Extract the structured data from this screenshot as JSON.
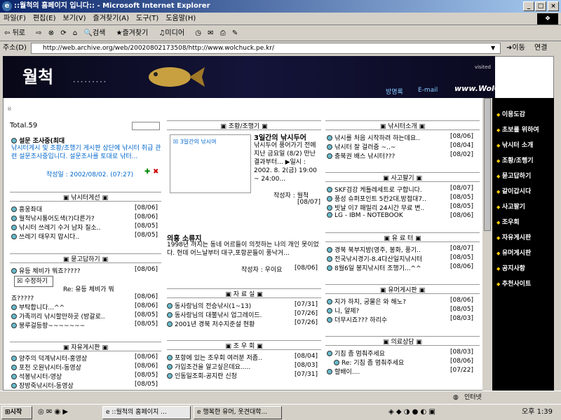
{
  "window": {
    "title": "::월척의 홈페이지 입니다:: - Microsoft Internet Explorer",
    "btn_min": "_",
    "btn_max": "□",
    "btn_close": "×"
  },
  "menu": [
    "파일(F)",
    "편집(E)",
    "보기(V)",
    "즐겨찾기(A)",
    "도구(T)",
    "도움말(H)"
  ],
  "toolbar": {
    "back": "뒤로",
    "search": "검색",
    "favorites": "즐겨찾기",
    "media": "미디어"
  },
  "address": {
    "label": "주소(D)",
    "url": "http://web.archive.org/web/20020802173508/http://www.wolchuck.pe.kr/",
    "go": "이동",
    "links": "연결"
  },
  "banner": {
    "logo": "월척",
    "visited": "visited",
    "nav1": "방명록",
    "nav2": "E-mail",
    "site": "www.WolChuck.pe.kr"
  },
  "sidebar": [
    "이용도감",
    "초보를 위하여",
    "낚시터 소개",
    "조황/조행기",
    "묻고답하기",
    "같이갑시다",
    "사고팔기",
    "조우회",
    "자유게시판",
    "유머게시판",
    "공지사항",
    "추천사이트"
  ],
  "left": {
    "total": "Total.59",
    "survey_title": "설문 조사중(최대",
    "survey_text": "낚시터게시 및 조황/조행기 게시판 상단에 낚시터 취급 관련 설문조사중입니다. 설문조사를 토대로 낚터...",
    "survey_date": "작성일 : 2002/08/02. (07:27)",
    "fish_title": "낚시터게선",
    "fish": [
      {
        "t": "흥웅좌대",
        "d": "[08/06]"
      },
      {
        "t": "월척낚시통어도색(?)다른가?",
        "d": "[08/06]"
      },
      {
        "t": "낚시터 쓰레기 수거 남자 질소..",
        "d": "[08/05]"
      },
      {
        "t": "쓰레기 태우지 맙시다..",
        "d": "[08/05]"
      }
    ],
    "qa_title": "묻고답하기",
    "qa": [
      {
        "t": "유등 체비가 뭐죠?????",
        "d": "[08/06]"
      },
      {
        "t": "Re: 유등 체비가 뭐",
        "d": ""
      },
      {
        "t": "죠?????",
        "d": "[08/06]"
      },
      {
        "t": "부탁합니다...^^",
        "d": "[08/06]"
      },
      {
        "t": "가족끼리 낚시할만하곳 (방갈로..",
        "d": "[08/05]"
      },
      {
        "t": "붕루걸등팡~~~~~~~",
        "d": "[08/05]"
      }
    ],
    "qa_popup": "수정하기",
    "free_title": "자유게시판",
    "free": [
      {
        "t": "양주의 덕계낚시터-홍영상",
        "d": "[08/06]"
      },
      {
        "t": "포천 오원낚시터-동영상",
        "d": "[08/06]"
      },
      {
        "t": "석봉낚시터-영상",
        "d": "[08/05]"
      },
      {
        "t": "장방죽낚시터-동영상",
        "d": "[08/05]"
      }
    ]
  },
  "mid": {
    "report_title": "조황/조행기",
    "report_img": "3일간의 낚시여",
    "report_head": "3일간의 낚시두어",
    "report_body": "낚시두어 풍어가기 전에 지난 금요일 (8/2) 만난 결과부터... ▶일시 : 2002. 8. 2(금) 19:00 ~ 24:00...",
    "report_author": "작성자 : 월척",
    "report_date": "[08/07]",
    "essay_title": "의흥 소류지",
    "essay_body": "1998년 까지는 동네 어르들이 의젓하는 나의 개인 못이었다. 헌데 어느날부터 대구,포항꾼들이 풍낙거...",
    "essay_author": "작성자 : 우이요",
    "essay_date": "[08/06]",
    "data_title": "자 료 실",
    "data": [
      {
        "t": "동사랑님의 전승낚시(1~13)",
        "d": "[07/31]"
      },
      {
        "t": "동사랑님의 대불낚시 업그레이드.",
        "d": "[07/26]"
      },
      {
        "t": "2001년 경북 저수지준설 현황",
        "d": "[07/26]"
      }
    ],
    "club_title": "조 우 회",
    "club": [
      {
        "t": "포항에 있는 조우회 여러분 저좀..",
        "d": "[08/04]"
      },
      {
        "t": "가입조건을 알고싶은데요.....",
        "d": "[08/03]"
      },
      {
        "t": "인동일조회-공지란 신청",
        "d": "[07/31]"
      }
    ]
  },
  "right": {
    "intro_title": "낚시터소개",
    "intro": [
      {
        "t": "낚시를 처음 시작하려 하는데요..",
        "d": "[08/06]"
      },
      {
        "t": "낚시터 잘 걸러줌 ~..~",
        "d": "[08/04]"
      },
      {
        "t": "충북권 배스 낚시터???",
        "d": "[08/02]"
      }
    ],
    "trade_title": "사고팔기",
    "trade": [
      {
        "t": "SKF검강 케틀레세트로 구합니다.",
        "d": "[08/07]"
      },
      {
        "t": "풍성 슈퍼포인트 5칸2대,방접대7..",
        "d": "[08/05]"
      },
      {
        "t": "빗날 이7 패밀리 24시간 무료 변..",
        "d": "[08/05]"
      },
      {
        "t": "LG - IBM - NOTEBOOK",
        "d": "[08/06]"
      }
    ],
    "notice_title": "유 료 터",
    "notice": [
      {
        "t": "경북 북부지방(영주, 봉화, 풍기..",
        "d": "[08/07]"
      },
      {
        "t": "전국낚시경기-8.4다산일지낚시터",
        "d": "[08/05]"
      },
      {
        "t": "8월6일 봉지낚시터 조행기...^^",
        "d": "[08/06]"
      }
    ],
    "humor_title": "유머게시판",
    "humor": [
      {
        "t": "지가 하지, 궁물은 와 해노?",
        "d": "[08/06]"
      },
      {
        "t": "니, 알제?",
        "d": "[08/05]"
      },
      {
        "t": "더무시죠??? 하리수",
        "d": "[08/03]"
      }
    ],
    "consult_title": "의료상담",
    "consult": [
      {
        "t": "기침 좀 멈춰주세요",
        "d": "[08/03]"
      },
      {
        "t": "Re: 기침 좀 멈춰주세요",
        "d": "[08/06]"
      },
      {
        "t": "할배이....",
        "d": "[07/22]"
      }
    ]
  },
  "status": {
    "zone": "인터넷"
  },
  "taskbar": {
    "start": "시작",
    "task1": "::월척의 홈페이지 ...",
    "task2": "행복한 유머, 옷견대학...",
    "clock": "오후 1:39"
  }
}
